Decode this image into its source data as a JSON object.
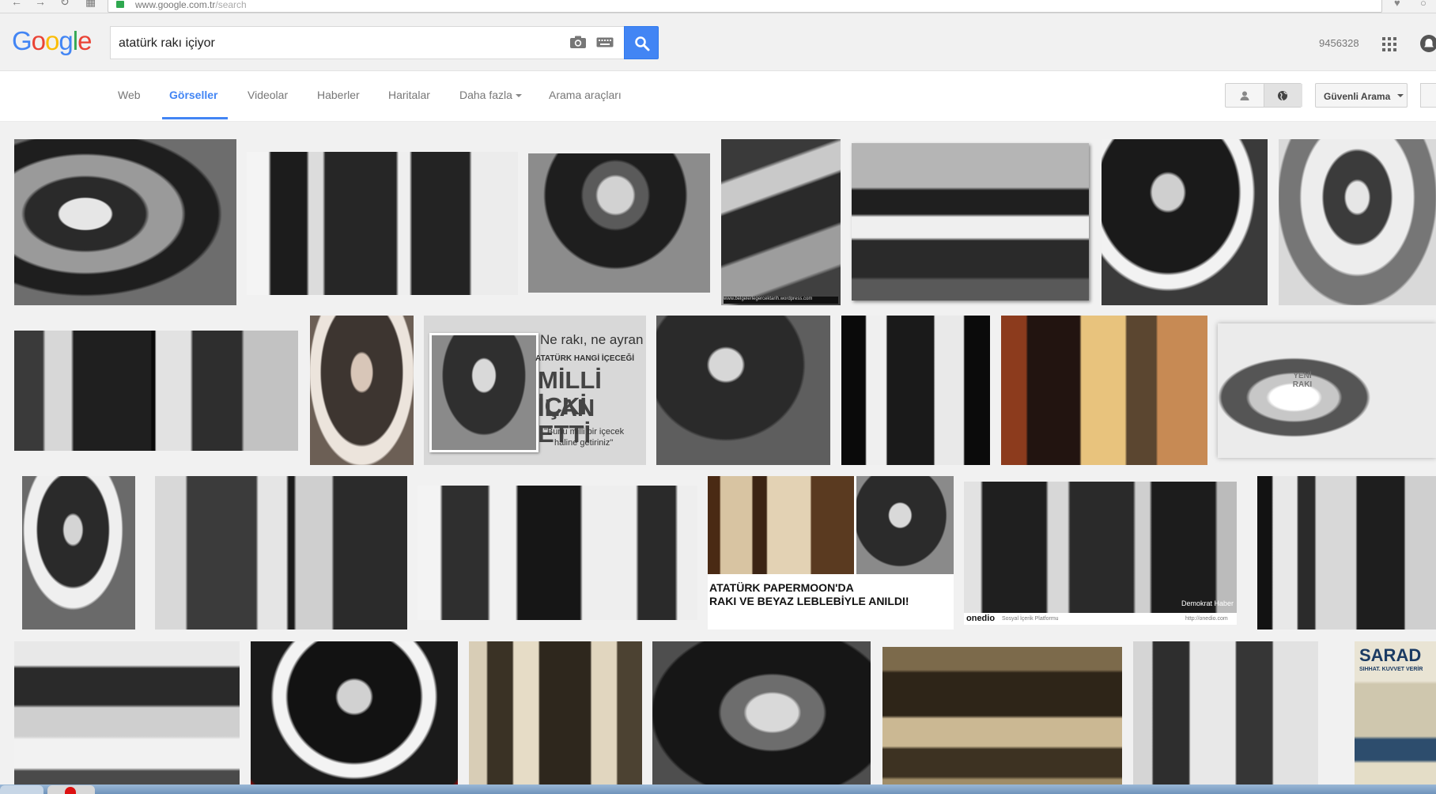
{
  "browser": {
    "url_host": "www.google.com.tr",
    "url_path": "/search"
  },
  "header": {
    "logo": [
      "G",
      "o",
      "o",
      "g",
      "l",
      "e"
    ],
    "query": "atatürk rakı içiyor",
    "account_id": "9456328"
  },
  "tabs": {
    "items": [
      "Web",
      "Görseller",
      "Videolar",
      "Haberler",
      "Haritalar",
      "Daha fazla",
      "Arama araçları"
    ],
    "active": "Görseller",
    "safe_search": "Güvenli Arama"
  },
  "thumbnails": {
    "t1_caption": "www.belgelerlegercektarih.wordpress.com",
    "t2_line1": "Ne rakı, ne ayran",
    "t2_line2": "ATATÜRK HANGİ İÇECEĞİ",
    "t2_line3": "MİLLİ İÇKİ",
    "t2_line4": "İLAN ETTİ",
    "t2_line5": "\"Bunu milli bir içecek",
    "t2_line6": "haline getiriniz\"",
    "t3_text": "YENİ RAKI",
    "t4_line1": "ATATÜRK PAPERMOON'DA",
    "t4_line2": "RAKI VE BEYAZ LEBLEBİYLE ANILDI!",
    "t5_brand": "onedio",
    "t5_tagline": "Sosyal İçerik Platformu",
    "t5_site": "http://onedio.com",
    "t5_watermark": "Demokrat Haber",
    "t6_text": "SARAD",
    "t6_sub": "SIHHAT. KUVVET VERİR"
  }
}
